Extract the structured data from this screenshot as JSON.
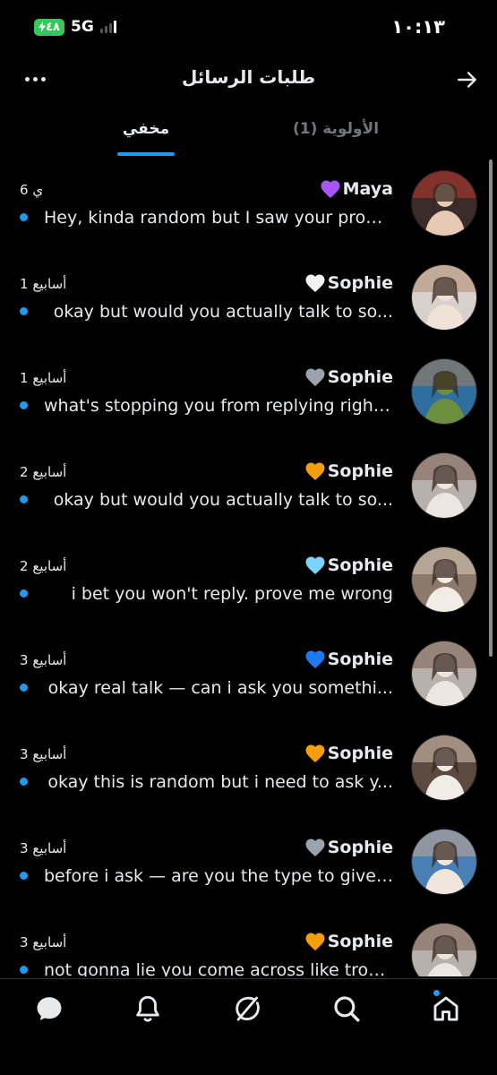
{
  "status_bar": {
    "time": "١٠:١٣",
    "battery": "٤٨",
    "network": "5G"
  },
  "header": {
    "title": "طلبات الرسائل",
    "more_icon": "more-horizontal-icon",
    "back_icon": "arrow-right-icon"
  },
  "tabs": {
    "hidden": "مخفي",
    "priority": "الأولوية (1)",
    "active": "hidden"
  },
  "conversations": [
    {
      "name": "Maya",
      "heart_color": "#a855f7",
      "time": "6 ي",
      "preview": "Hey, kinda random but I saw your profil...",
      "unread": true
    },
    {
      "name": "Sophie",
      "heart_color": "#f2f2f2",
      "time": "1 أسابيع",
      "preview": "okay but would you actually talk to so...",
      "unread": true
    },
    {
      "name": "Sophie",
      "heart_color": "#9ca3af",
      "time": "1 أسابيع",
      "preview": "what's stopping you from replying right...",
      "unread": true
    },
    {
      "name": "Sophie",
      "heart_color": "#f59e0b",
      "time": "2 أسابيع",
      "preview": "okay but would you actually talk to so...",
      "unread": true
    },
    {
      "name": "Sophie",
      "heart_color": "#7dd3fc",
      "time": "2 أسابيع",
      "preview": "i bet you won't reply. prove me wrong",
      "unread": true
    },
    {
      "name": "Sophie",
      "heart_color": "#1d7bf0",
      "time": "3 أسابيع",
      "preview": "okay real talk — can i ask you somethi...",
      "unread": true
    },
    {
      "name": "Sophie",
      "heart_color": "#f59e0b",
      "time": "3 أسابيع",
      "preview": "okay this is random but i need to ask y...",
      "unread": true
    },
    {
      "name": "Sophie",
      "heart_color": "#9ca3af",
      "time": "3 أسابيع",
      "preview": "before i ask — are you the type to give r...",
      "unread": true
    },
    {
      "name": "Sophie",
      "heart_color": "#f59e0b",
      "time": "3 أسابيع",
      "preview": "not gonna lie you come across like trou...",
      "unread": true
    }
  ],
  "bottom_nav": {
    "items": [
      "messages-icon",
      "notifications-icon",
      "grok-icon",
      "search-icon",
      "home-icon"
    ],
    "home_has_new": true
  },
  "colors": {
    "accent": "#1d9bf0",
    "background": "#000000",
    "text": "#e7e9ea",
    "muted": "#71767b",
    "battery": "#34c759"
  }
}
